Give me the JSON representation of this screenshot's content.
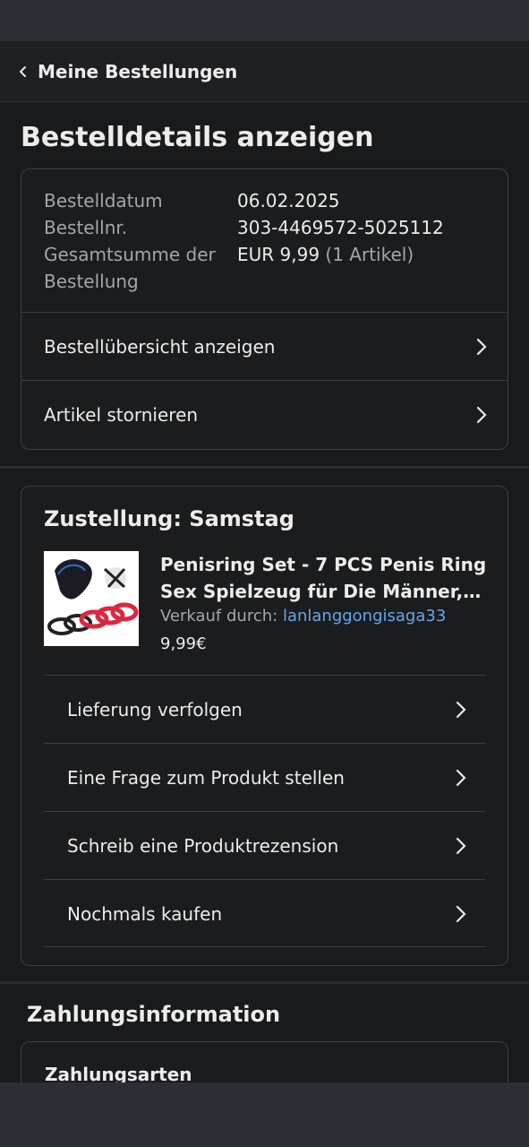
{
  "nav": {
    "back_label": "Meine Bestellungen"
  },
  "page": {
    "title": "Bestelldetails anzeigen"
  },
  "order": {
    "date_label": "Bestelldatum",
    "date_value": "06.02.2025",
    "number_label": "Bestellnr.",
    "number_value": "303-4469572-5025112",
    "total_label": "Gesamtsumme der Bestellung",
    "total_label_line1": "Gesamtsumme der",
    "total_label_line2": "Bestellung",
    "total_value": "EUR 9,99",
    "total_count": "(1 Artikel)",
    "links": [
      "Bestellübersicht anzeigen",
      "Artikel stornieren"
    ]
  },
  "delivery": {
    "title": "Zustellung: Samstag",
    "product": {
      "title_line1": "Penisring Set - 7 PCS Penis Ring",
      "title_line2": "Sex Spielzeug für Die Männer, C...",
      "seller_label": "Verkauf durch:",
      "seller_name": "lanlanggongisaga33",
      "price": "9,99€"
    },
    "actions": [
      "Lieferung verfolgen",
      "Eine Frage zum Produkt stellen",
      "Schreib eine Produktrezension",
      "Nochmals kaufen"
    ]
  },
  "payment": {
    "section_title": "Zahlungsinformation",
    "methods_label": "Zahlungsarten"
  },
  "colors": {
    "background": "#191a1c",
    "card_border": "#3d3e42",
    "link": "#66a8e8",
    "muted": "#a5a6a9"
  }
}
